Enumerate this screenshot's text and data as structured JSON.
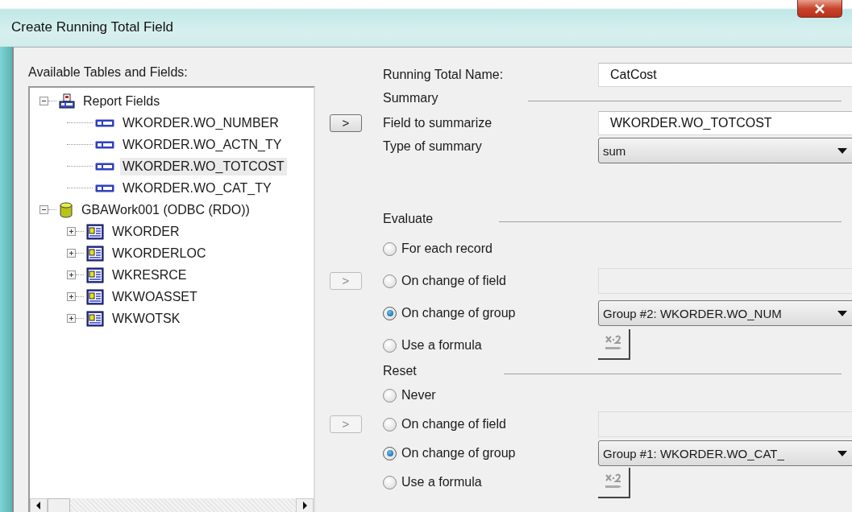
{
  "window": {
    "title": "Create Running Total Field"
  },
  "fields_panel": {
    "label": "Available Tables and Fields:",
    "tree": [
      {
        "label": "Report Fields",
        "kind": "report",
        "expanded": true,
        "selected": false,
        "children": [
          {
            "label": "WKORDER.WO_NUMBER",
            "kind": "field",
            "selected": false
          },
          {
            "label": "WKORDER.WO_ACTN_TY",
            "kind": "field",
            "selected": false
          },
          {
            "label": "WKORDER.WO_TOTCOST",
            "kind": "field",
            "selected": true
          },
          {
            "label": "WKORDER.WO_CAT_TY",
            "kind": "field",
            "selected": false
          }
        ]
      },
      {
        "label": "GBAWork001 (ODBC (RDO))",
        "kind": "database",
        "expanded": true,
        "selected": false,
        "children": [
          {
            "label": "WKORDER",
            "kind": "table",
            "expanded": false,
            "selected": false
          },
          {
            "label": "WKORDERLOC",
            "kind": "table",
            "expanded": false,
            "selected": false
          },
          {
            "label": "WKRESRCE",
            "kind": "table",
            "expanded": false,
            "selected": false
          },
          {
            "label": "WKWOASSET",
            "kind": "table",
            "expanded": false,
            "selected": false
          },
          {
            "label": "WKWOTSK",
            "kind": "table",
            "expanded": false,
            "selected": false
          }
        ]
      }
    ]
  },
  "running_total_name": {
    "label": "Running Total Name:",
    "value": "CatCost"
  },
  "summary": {
    "heading": "Summary",
    "add_button": {
      "label": ">",
      "disabled": false
    },
    "field_label": "Field to summarize",
    "field_value": "WKORDER.WO_TOTCOST",
    "type_label": "Type of summary",
    "type_value": "sum"
  },
  "sections": [
    {
      "heading": "Evaluate",
      "add_button": {
        "label": ">",
        "disabled": true
      },
      "options": [
        {
          "label": "For each record",
          "kind": "plain",
          "selected": false
        },
        {
          "label": "On change of field",
          "kind": "field",
          "selected": false
        },
        {
          "label": "On change of group",
          "kind": "group",
          "selected": true,
          "value": "Group #2: WKORDER.WO_NUM"
        },
        {
          "label": "Use a formula",
          "kind": "formula",
          "selected": false
        }
      ]
    },
    {
      "heading": "Reset",
      "add_button": {
        "label": ">",
        "disabled": true
      },
      "options": [
        {
          "label": "Never",
          "kind": "plain",
          "selected": false
        },
        {
          "label": "On change of field",
          "kind": "field",
          "selected": false
        },
        {
          "label": "On change of group",
          "kind": "group",
          "selected": true,
          "value": "Group #1: WKORDER.WO_CAT_"
        },
        {
          "label": "Use a formula",
          "kind": "formula",
          "selected": false
        }
      ]
    }
  ]
}
